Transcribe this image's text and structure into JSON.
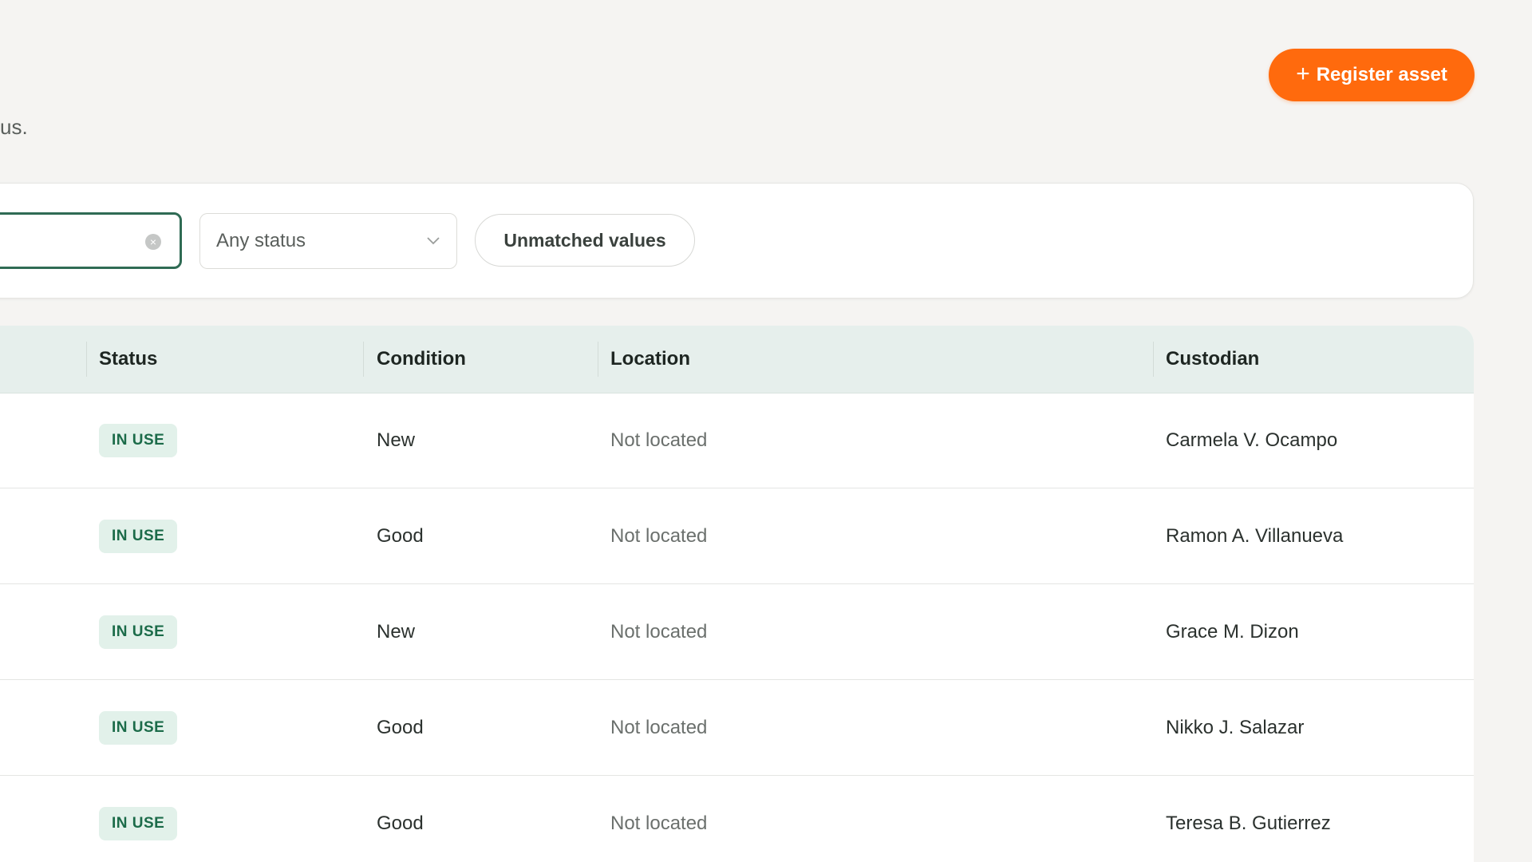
{
  "header": {
    "subtitle_fragment": "us.",
    "register_button_label": "Register asset"
  },
  "filters": {
    "search_value": "",
    "status_select_value": "Any status",
    "unmatched_label": "Unmatched values"
  },
  "table": {
    "columns": {
      "status": "Status",
      "condition": "Condition",
      "location": "Location",
      "custodian": "Custodian"
    },
    "rows": [
      {
        "status": "IN USE",
        "condition": "New",
        "location": "Not located",
        "custodian": "Carmela V. Ocampo"
      },
      {
        "status": "IN USE",
        "condition": "Good",
        "location": "Not located",
        "custodian": "Ramon A. Villanueva"
      },
      {
        "status": "IN USE",
        "condition": "New",
        "location": "Not located",
        "custodian": "Grace M. Dizon"
      },
      {
        "status": "IN USE",
        "condition": "Good",
        "location": "Not located",
        "custodian": "Nikko J. Salazar"
      },
      {
        "status": "IN USE",
        "condition": "Good",
        "location": "Not located",
        "custodian": "Teresa B. Gutierrez"
      }
    ]
  },
  "colors": {
    "accent_orange": "#ff6a0d",
    "focus_green": "#2f6b54",
    "badge_bg": "#e2f1ea",
    "badge_text": "#1b6b49",
    "header_bg": "#e6efec"
  },
  "icons": {
    "plus": "plus-icon",
    "clear": "clear-icon",
    "chevron": "chevron-down-icon"
  }
}
